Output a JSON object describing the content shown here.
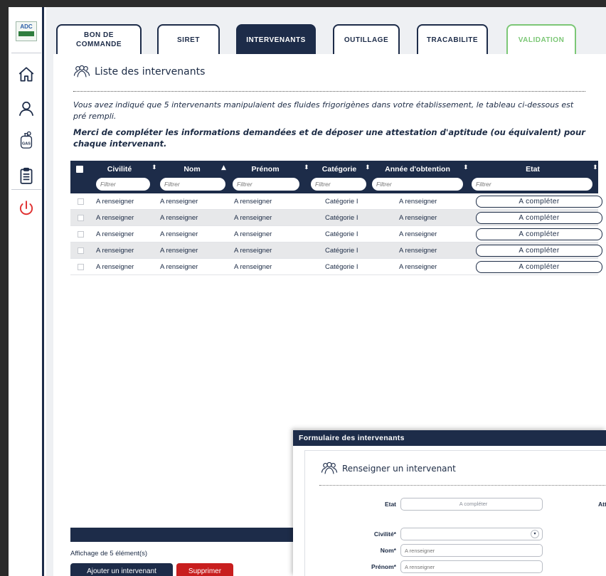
{
  "app": {
    "logo_text_top": "ADC",
    "logo_text_sub": "Fluides",
    "accent_color": "#1d2c49",
    "success_color": "#7cc776",
    "danger_color": "#c81e1e"
  },
  "sidebar": {
    "items": [
      {
        "icon": "home-icon"
      },
      {
        "icon": "user-icon"
      },
      {
        "icon": "gas-bottle-icon",
        "label": "GAS"
      },
      {
        "icon": "clipboard-icon"
      },
      {
        "icon": "power-icon"
      }
    ]
  },
  "tabs": [
    {
      "label": "BON DE COMMANDE",
      "state": "default"
    },
    {
      "label": "SIRET",
      "state": "default"
    },
    {
      "label": "INTERVENANTS",
      "state": "active"
    },
    {
      "label": "OUTILLAGE",
      "state": "default"
    },
    {
      "label": "TRACABILITE",
      "state": "default"
    },
    {
      "label": "VALIDATION",
      "state": "validation"
    }
  ],
  "section": {
    "title": "Liste des intervenants",
    "intro": "Vous avez indiqué que 5 intervenants manipulaient des fluides frigorigènes dans votre établissement, le tableau ci-dessous est pré rempli.",
    "instruction": "Merci de compléter les informations demandées et de déposer une attestation d'aptitude (ou équivalent) pour chaque intervenant."
  },
  "table": {
    "columns": [
      {
        "label": "Civilité",
        "filter_placeholder": "Filtrer"
      },
      {
        "label": "Nom",
        "filter_placeholder": "Filtrer"
      },
      {
        "label": "Prénom",
        "filter_placeholder": "Filtrer"
      },
      {
        "label": "Catégorie",
        "filter_placeholder": "Filtrer"
      },
      {
        "label": "Année d'obtention",
        "filter_placeholder": "Filtrer"
      },
      {
        "label": "Etat",
        "filter_placeholder": "Filtrer"
      }
    ],
    "rows": [
      {
        "civilite": "A renseigner",
        "nom": "A renseigner",
        "prenom": "A renseigner",
        "categorie": "Catégorie I",
        "annee": "A renseigner",
        "etat": "A compléter"
      },
      {
        "civilite": "A renseigner",
        "nom": "A renseigner",
        "prenom": "A renseigner",
        "categorie": "Catégorie I",
        "annee": "A renseigner",
        "etat": "A compléter"
      },
      {
        "civilite": "A renseigner",
        "nom": "A renseigner",
        "prenom": "A renseigner",
        "categorie": "Catégorie I",
        "annee": "A renseigner",
        "etat": "A compléter"
      },
      {
        "civilite": "A renseigner",
        "nom": "A renseigner",
        "prenom": "A renseigner",
        "categorie": "Catégorie I",
        "annee": "A renseigner",
        "etat": "A compléter"
      },
      {
        "civilite": "A renseigner",
        "nom": "A renseigner",
        "prenom": "A renseigner",
        "categorie": "Catégorie I",
        "annee": "A renseigner",
        "etat": "A compléter"
      }
    ]
  },
  "footer": {
    "count_text": "Affichage de 5 élément(s)",
    "add_label": "Ajouter un intervenant",
    "delete_label": "Supprimer"
  },
  "modal": {
    "header": "Formulaire des intervenants",
    "title": "Renseigner un intervenant",
    "etat_label": "Etat",
    "etat_value": "A compléter",
    "att_label": "Att",
    "civilite_label": "Civilité*",
    "civilite_value": "",
    "nom_label": "Nom*",
    "nom_placeholder": "A renseigner",
    "prenom_label": "Prénom*",
    "prenom_placeholder": "A renseigner"
  }
}
